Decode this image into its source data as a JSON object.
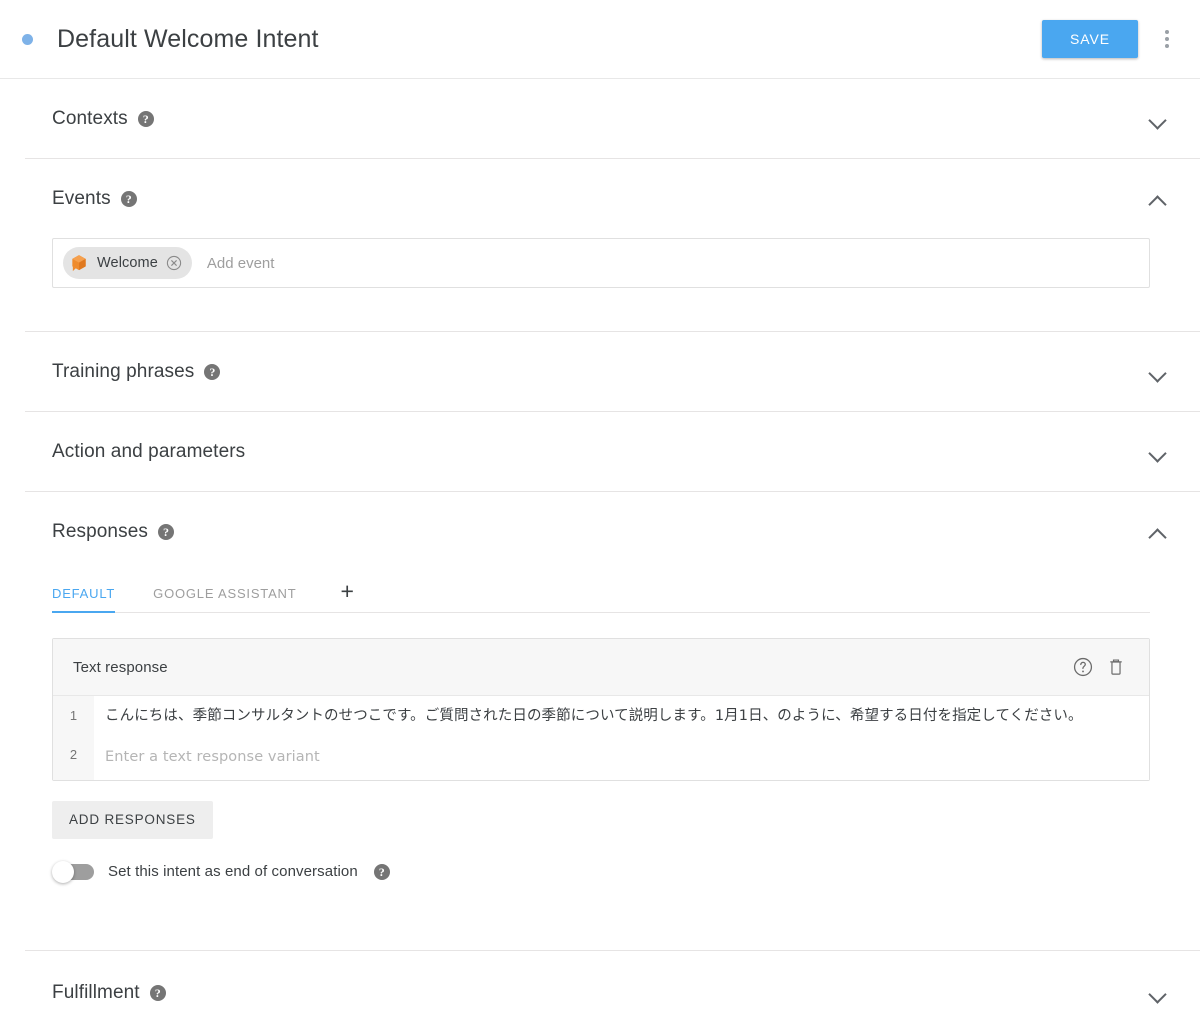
{
  "header": {
    "status_dot_color": "#7eb2e8",
    "title": "Default Welcome Intent",
    "save_label": "SAVE",
    "more_menu_name": "more-options"
  },
  "sections": {
    "contexts": {
      "title": "Contexts",
      "help": "?",
      "expanded": false
    },
    "events": {
      "title": "Events",
      "help": "?",
      "expanded": true,
      "chip": {
        "label": "Welcome",
        "icon": "dialogflow-icon",
        "remove_icon": "remove-chip-icon"
      },
      "placeholder": "Add event"
    },
    "training_phrases": {
      "title": "Training phrases",
      "help": "?",
      "expanded": false
    },
    "action_and_parameters": {
      "title": "Action and parameters",
      "expanded": false
    },
    "responses": {
      "title": "Responses",
      "help": "?",
      "expanded": true,
      "tabs": [
        {
          "label": "DEFAULT",
          "active": true
        },
        {
          "label": "GOOGLE ASSISTANT",
          "active": false
        }
      ],
      "add_tab_label": "+",
      "card": {
        "title": "Text response",
        "help_icon": "help-outline-icon",
        "delete_icon": "trash-icon",
        "rows": [
          {
            "num": "1",
            "text": "こんにちは、季節コンサルタントのせつこです。ご質問された日の季節について説明します。1月1日、のように、希望する日付を指定してください。",
            "is_placeholder": false
          },
          {
            "num": "2",
            "text": "Enter a text response variant",
            "is_placeholder": true
          }
        ]
      },
      "add_responses_label": "ADD RESPONSES",
      "end_of_conversation": {
        "label": "Set this intent as end of conversation",
        "help": "?",
        "enabled": false
      }
    },
    "fulfillment": {
      "title": "Fulfillment",
      "help": "?",
      "expanded": false
    }
  },
  "colors": {
    "accent": "#4aa7f0",
    "chip_icon": "#e8822a",
    "divider": "#e6e4e4",
    "text_primary": "#3c4043",
    "text_muted": "#9e9e9e"
  }
}
